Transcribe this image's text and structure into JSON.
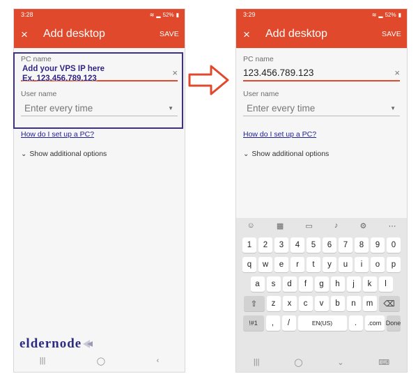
{
  "left": {
    "status": {
      "time": "3:28",
      "battery": "52%"
    },
    "appbar": {
      "close": "×",
      "title": "Add desktop",
      "save": "SAVE"
    },
    "pc_name": {
      "label": "PC name",
      "value": "",
      "clear": "×"
    },
    "user_name": {
      "label": "User name",
      "value": "Enter every time"
    },
    "link": "How do I set up a PC?",
    "options": "Show additional options",
    "annotation": {
      "line1": "Add your VPS IP here",
      "line2": "Ex. 123.456.789.123"
    }
  },
  "right": {
    "status": {
      "time": "3:29",
      "battery": "52%"
    },
    "appbar": {
      "close": "×",
      "title": "Add desktop",
      "save": "SAVE"
    },
    "pc_name": {
      "label": "PC name",
      "value": "123.456.789.123",
      "clear": "×"
    },
    "user_name": {
      "label": "User name",
      "value": "Enter every time"
    },
    "link": "How do I set up a PC?",
    "options": "Show additional options"
  },
  "keyboard": {
    "row1": [
      "1",
      "2",
      "3",
      "4",
      "5",
      "6",
      "7",
      "8",
      "9",
      "0"
    ],
    "row2": [
      "q",
      "w",
      "e",
      "r",
      "t",
      "y",
      "u",
      "i",
      "o",
      "p"
    ],
    "row3": [
      "a",
      "s",
      "d",
      "f",
      "g",
      "h",
      "j",
      "k",
      "l"
    ],
    "row4": [
      "z",
      "x",
      "c",
      "v",
      "b",
      "n",
      "m"
    ],
    "symbols": "!#1",
    "comma": ",",
    "slash": "/",
    "space": "EN(US)",
    "period": ".",
    "dotcom": ".com",
    "done": "Done"
  },
  "logo": {
    "text": "eldernode"
  },
  "colors": {
    "accent": "#e0492b",
    "highlight": "#3b2f8f",
    "link": "#1d1d9b"
  }
}
